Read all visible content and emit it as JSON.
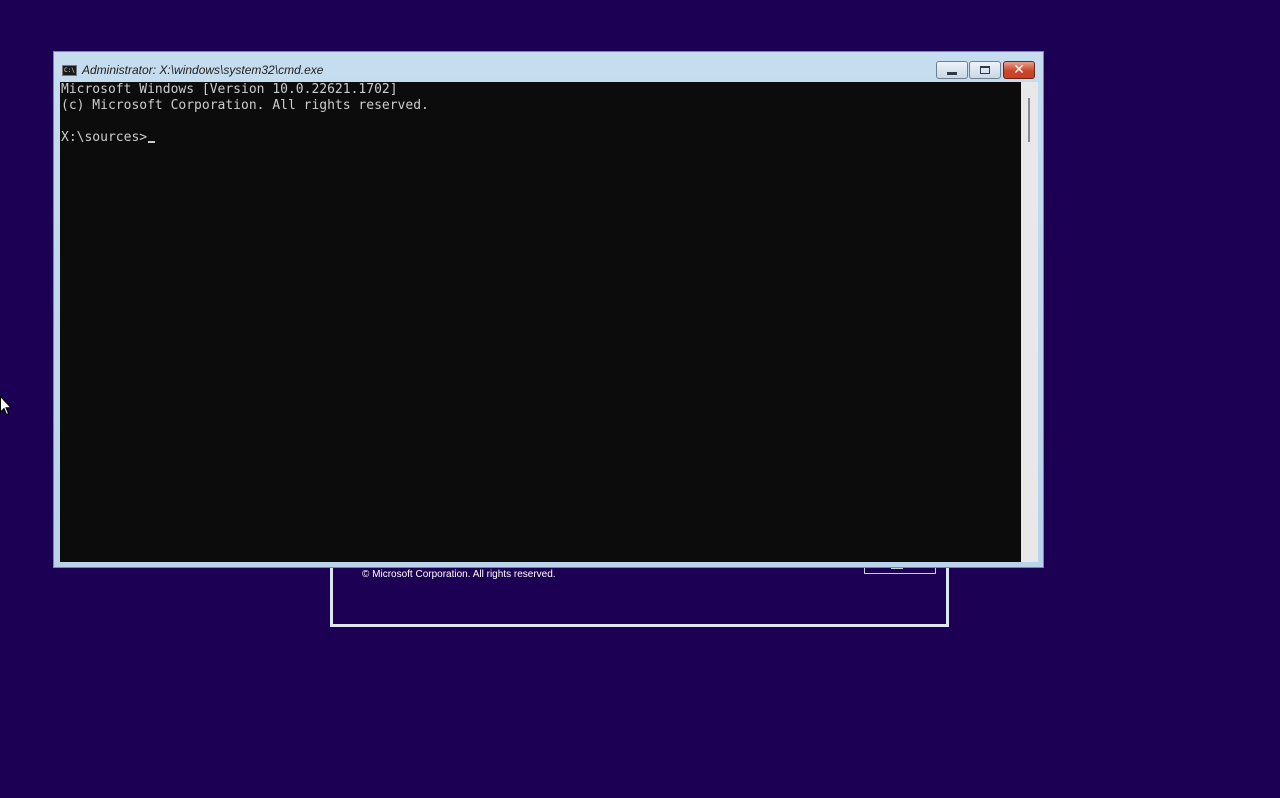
{
  "desktop": {
    "background_color": "#1b0054"
  },
  "setup_window": {
    "copyright": "© Microsoft Corporation. All rights reserved."
  },
  "cmd_window": {
    "title": "Administrator: X:\\windows\\system32\\cmd.exe",
    "icon_text": "C:\\",
    "buttons": {
      "minimize": "minimize-icon",
      "maximize": "maximize-icon",
      "close_glyph": "✕"
    },
    "console": {
      "lines": [
        "Microsoft Windows [Version 10.0.22621.1702]",
        "(c) Microsoft Corporation. All rights reserved.",
        "",
        "X:\\sources>"
      ],
      "background_color": "#0c0c0c",
      "text_color": "#cccccc"
    }
  }
}
